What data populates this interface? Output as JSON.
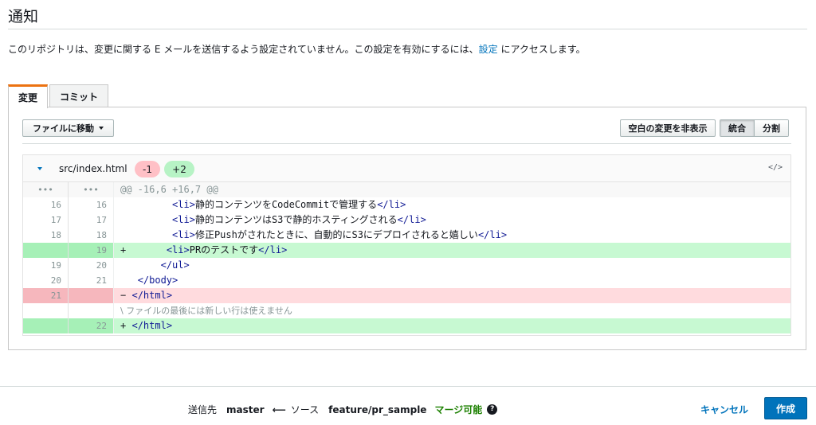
{
  "section": {
    "title": "通知",
    "notice_text": "このリポジトリは、変更に関する E メールを送信するよう設定されていません。この設定を有効にするには、",
    "notice_link": "設定",
    "notice_suffix": " にアクセスします。"
  },
  "tabs": [
    {
      "label": "変更",
      "active": true
    },
    {
      "label": "コミット",
      "active": false
    }
  ],
  "toolbar": {
    "goto_file_label": "ファイルに移動",
    "hide_whitespace_label": "空白の変更を非表示",
    "view_modes": [
      {
        "label": "統合",
        "selected": true
      },
      {
        "label": "分割",
        "selected": false
      }
    ]
  },
  "file": {
    "name": "src/index.html",
    "deletions": "-1",
    "additions": "+2",
    "code_icon": "</>"
  },
  "diff": {
    "hunk_marker": "•••",
    "hunk_header": "@@ -16,6 +16,7 @@",
    "lines": [
      {
        "type": "ctx",
        "old": "16",
        "new": "16",
        "sign": " ",
        "indent": "        ",
        "open": "<li>",
        "text": "静的コンテンツをCodeCommitで管理する",
        "close": "</li>"
      },
      {
        "type": "ctx",
        "old": "17",
        "new": "17",
        "sign": " ",
        "indent": "        ",
        "open": "<li>",
        "text": "静的コンテンツはS3で静的ホスティングされる",
        "close": "</li>"
      },
      {
        "type": "ctx",
        "old": "18",
        "new": "18",
        "sign": " ",
        "indent": "        ",
        "open": "<li>",
        "text": "修正Pushがされたときに、自動的にS3にデプロイされると嬉しい",
        "close": "</li>"
      },
      {
        "type": "add",
        "old": "",
        "new": "19",
        "sign": "+",
        "indent": "       ",
        "open": "<li>",
        "text": "PRのテストです",
        "close": "</li>"
      },
      {
        "type": "ctx",
        "old": "19",
        "new": "20",
        "sign": " ",
        "indent": "      ",
        "open": "</ul>",
        "text": "",
        "close": ""
      },
      {
        "type": "ctx",
        "old": "20",
        "new": "21",
        "sign": " ",
        "indent": "  ",
        "open": "</body>",
        "text": "",
        "close": ""
      },
      {
        "type": "del",
        "old": "21",
        "new": "",
        "sign": "−",
        "indent": " ",
        "open": "</html>",
        "text": "",
        "close": ""
      },
      {
        "type": "note",
        "old": "",
        "new": "",
        "sign": "",
        "indent": "",
        "open": "",
        "text": "\\ ファイルの最後には新しい行は使えません",
        "close": ""
      },
      {
        "type": "add",
        "old": "",
        "new": "22",
        "sign": "+",
        "indent": " ",
        "open": "</html>",
        "text": "",
        "close": ""
      }
    ]
  },
  "footer": {
    "dest_label": "送信先",
    "dest_value": "master",
    "arrow": "⟵",
    "source_label": "ソース",
    "source_value": "feature/pr_sample",
    "merge_status": "マージ可能",
    "help_icon": "?",
    "cancel_label": "キャンセル",
    "create_label": "作成"
  },
  "colors": {
    "accent": "#0073bb",
    "tab_active_border": "#ec7211",
    "merge_ok": "#1d8102",
    "add_bg": "#c7f9d2",
    "del_bg": "#ffdbde"
  }
}
